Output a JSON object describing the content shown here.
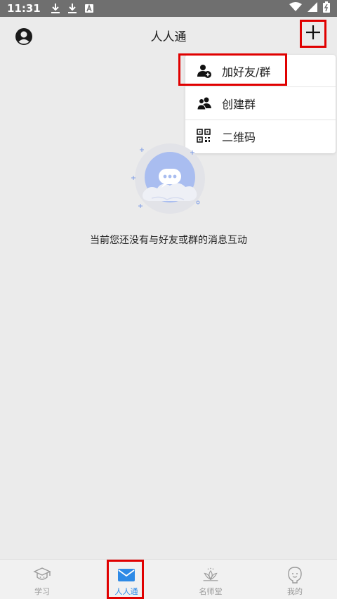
{
  "status_bar": {
    "time": "11:31"
  },
  "header": {
    "title": "人人通"
  },
  "menu": {
    "items": [
      {
        "label": "加好友/群",
        "icon": "add-friend-icon"
      },
      {
        "label": "创建群",
        "icon": "create-group-icon"
      },
      {
        "label": "二维码",
        "icon": "qr-code-icon"
      }
    ]
  },
  "empty_state": {
    "message": "当前您还没有与好友或群的消息互动"
  },
  "tab_bar": {
    "tabs": [
      {
        "label": "学习",
        "icon": "graduation-cap-icon",
        "active": false
      },
      {
        "label": "人人通",
        "icon": "mail-icon",
        "active": true
      },
      {
        "label": "名师堂",
        "icon": "lotus-icon",
        "active": false
      },
      {
        "label": "我的",
        "icon": "profile-face-icon",
        "active": false
      }
    ]
  },
  "colors": {
    "background": "#ebebeb",
    "accent": "#2e8ae6",
    "highlight": "#e00000",
    "status_bar": "#6f6f6f"
  }
}
